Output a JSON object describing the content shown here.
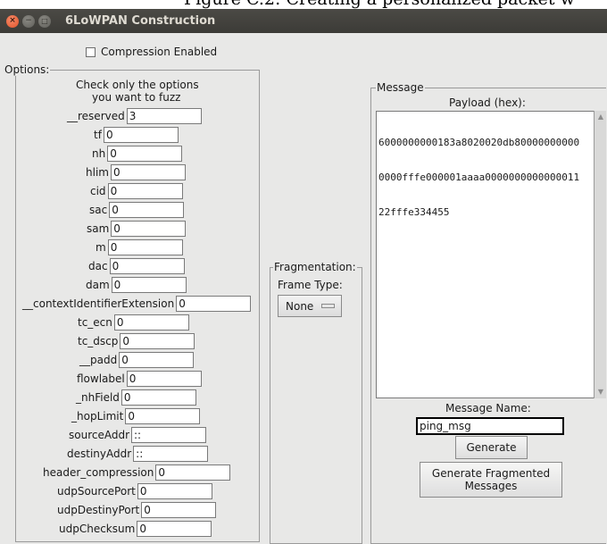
{
  "document_caption": "Figure C.2:  Creating a personalized packet w",
  "window": {
    "title": "6LoWPAN Construction",
    "controls": {
      "close": "×",
      "minimize": "−",
      "maximize": "□"
    }
  },
  "compression": {
    "label": "Compression Enabled",
    "checked": false
  },
  "options": {
    "legend": "Options:",
    "instruction_line1": "Check only the options",
    "instruction_line2": "you want to fuzz",
    "fields": [
      {
        "label": "__reserved",
        "value": "3"
      },
      {
        "label": "tf",
        "value": "0"
      },
      {
        "label": "nh",
        "value": "0"
      },
      {
        "label": "hlim",
        "value": "0"
      },
      {
        "label": "cid",
        "value": "0"
      },
      {
        "label": "sac",
        "value": "0"
      },
      {
        "label": "sam",
        "value": "0"
      },
      {
        "label": "m",
        "value": "0"
      },
      {
        "label": "dac",
        "value": "0"
      },
      {
        "label": "dam",
        "value": "0"
      },
      {
        "label": "__contextIdentifierExtension",
        "value": "0"
      },
      {
        "label": "tc_ecn",
        "value": "0"
      },
      {
        "label": "tc_dscp",
        "value": "0"
      },
      {
        "label": "__padd",
        "value": "0"
      },
      {
        "label": "flowlabel",
        "value": "0"
      },
      {
        "label": "_nhField",
        "value": "0"
      },
      {
        "label": "_hopLimit",
        "value": "0"
      },
      {
        "label": "sourceAddr",
        "value": "::"
      },
      {
        "label": "destinyAddr",
        "value": "::"
      },
      {
        "label": "header_compression",
        "value": "0"
      },
      {
        "label": "udpSourcePort",
        "value": "0"
      },
      {
        "label": "udpDestinyPort",
        "value": "0"
      },
      {
        "label": "udpChecksum",
        "value": "0"
      }
    ]
  },
  "fragmentation": {
    "legend": "Fragmentation:",
    "frame_type_label": "Frame Type:",
    "frame_type_value": "None"
  },
  "message": {
    "legend": "Message",
    "payload_label": "Payload (hex):",
    "payload_line1": "6000000000183a8020020db80000000000",
    "payload_line2": "0000fffe000001aaaa0000000000000011",
    "payload_line3": "22fffe334455",
    "message_name_label": "Message Name:",
    "message_name_value": "ping_msg",
    "generate_label": "Generate",
    "generate_fragmented_line1": "Generate Fragmented",
    "generate_fragmented_line2": "Messages"
  },
  "scroll": {
    "up_arrow": "▲",
    "down_arrow": "▼"
  }
}
